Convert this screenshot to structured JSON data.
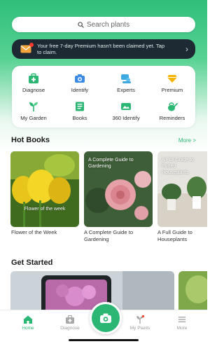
{
  "search": {
    "placeholder": "Search plants"
  },
  "promo": {
    "text": "Your free 7-day Premium hasn't been claimed yet. Tap to claim."
  },
  "features": [
    {
      "label": "Diagnose",
      "icon": "first-aid-kit-icon"
    },
    {
      "label": "Identify",
      "icon": "camera-icon"
    },
    {
      "label": "Experts",
      "icon": "expert-chat-icon"
    },
    {
      "label": "Premium",
      "icon": "diamond-icon"
    },
    {
      "label": "My Garden",
      "icon": "sprout-icon"
    },
    {
      "label": "Books",
      "icon": "book-icon"
    },
    {
      "label": "360 Identify",
      "icon": "panorama-icon"
    },
    {
      "label": "Reminders",
      "icon": "watering-can-icon"
    }
  ],
  "hot_books": {
    "title": "Hot Books",
    "more": "More >",
    "items": [
      {
        "cover": "Flower of the week",
        "caption": "Flower of the Week"
      },
      {
        "cover": "A Complete Guide to Gardening",
        "caption": "A Complete Guide to Gardening"
      },
      {
        "cover": "A Full Guide to Potted Houseplants",
        "caption": "A Full Guide to Houseplants"
      }
    ]
  },
  "get_started": {
    "title": "Get Started"
  },
  "tabs": [
    {
      "label": "Home",
      "active": true
    },
    {
      "label": "Diagnose",
      "active": false
    },
    {
      "label": "My Plants",
      "active": false
    },
    {
      "label": "More",
      "active": false
    }
  ],
  "colors": {
    "accent": "#2cb673",
    "promo_bg": "#1d2a33",
    "header_green": "#2fbf7a"
  }
}
